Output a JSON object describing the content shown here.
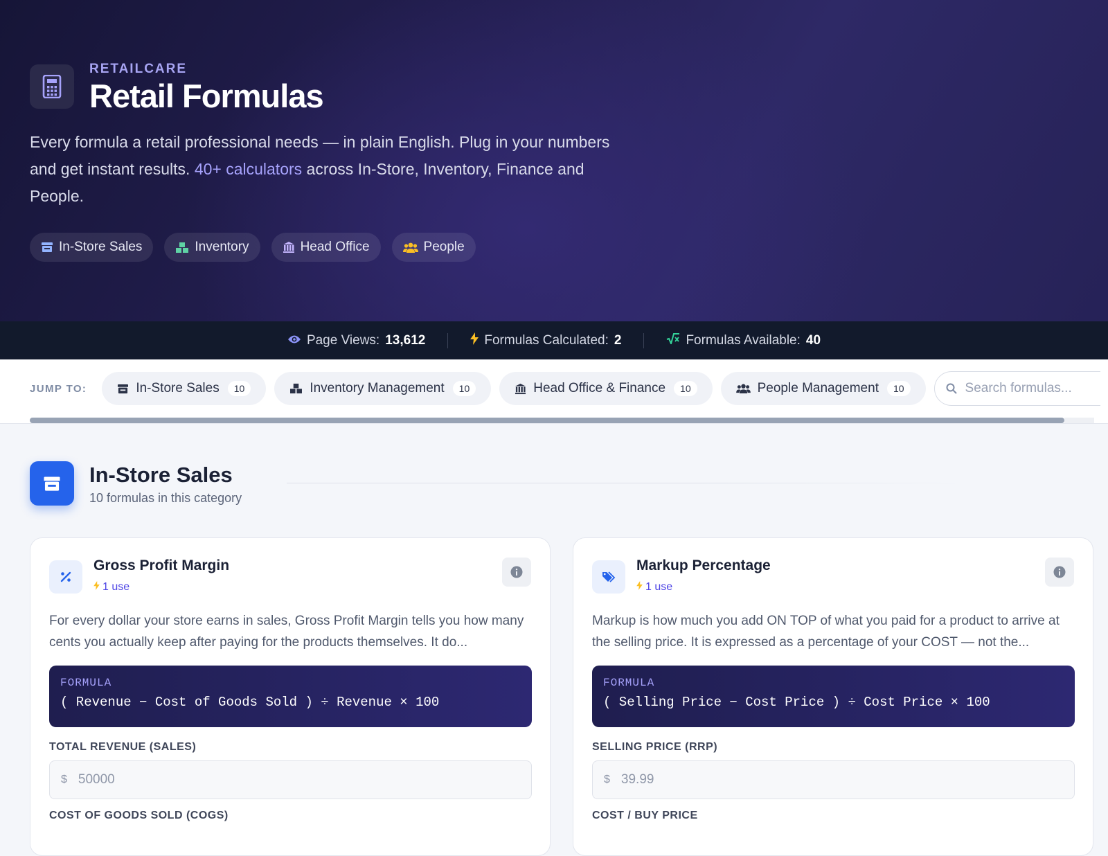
{
  "hero": {
    "eyebrow": "RETAILCARE",
    "title": "Retail Formulas",
    "desc_before": "Every formula a retail professional needs — in plain English. Plug in your numbers and get instant results. ",
    "desc_highlight": "40+ calculators",
    "desc_after": " across In-Store, Inventory, Finance and People.",
    "pills": [
      "In-Store Sales",
      "Inventory",
      "Head Office",
      "People"
    ]
  },
  "stats": {
    "page_views_label": "Page Views:",
    "page_views_value": "13,612",
    "calculated_label": "Formulas Calculated:",
    "calculated_value": "2",
    "available_label": "Formulas Available:",
    "available_value": "40"
  },
  "jump": {
    "label": "JUMP TO:",
    "items": [
      {
        "label": "In-Store Sales",
        "count": "10"
      },
      {
        "label": "Inventory Management",
        "count": "10"
      },
      {
        "label": "Head Office & Finance",
        "count": "10"
      },
      {
        "label": "People Management",
        "count": "10"
      }
    ],
    "search_placeholder": "Search formulas..."
  },
  "section": {
    "title": "In-Store Sales",
    "subtitle": "10 formulas in this category"
  },
  "cards": [
    {
      "title": "Gross Profit Margin",
      "uses": "1 use",
      "desc": "For every dollar your store earns in sales, Gross Profit Margin tells you how many cents you actually keep after paying for the products themselves. It do...",
      "formula_label": "FORMULA",
      "formula": "( Revenue − Cost of Goods Sold ) ÷ Revenue × 100",
      "field1_label": "TOTAL REVENUE (SALES)",
      "field1_prefix": "$",
      "field1_placeholder": "50000",
      "field2_label": "COST OF GOODS SOLD (COGS)"
    },
    {
      "title": "Markup Percentage",
      "uses": "1 use",
      "desc": "Markup is how much you add ON TOP of what you paid for a product to arrive at the selling price. It is expressed as a percentage of your COST — not the...",
      "formula_label": "FORMULA",
      "formula": "( Selling Price − Cost Price ) ÷ Cost Price × 100",
      "field1_label": "SELLING PRICE (RRP)",
      "field1_prefix": "$",
      "field1_placeholder": "39.99",
      "field2_label": "COST / BUY PRICE"
    }
  ],
  "colors": {
    "accent": "#4f46e5",
    "section_icon": "#2563eb",
    "stats_bar": "#121a2c"
  }
}
